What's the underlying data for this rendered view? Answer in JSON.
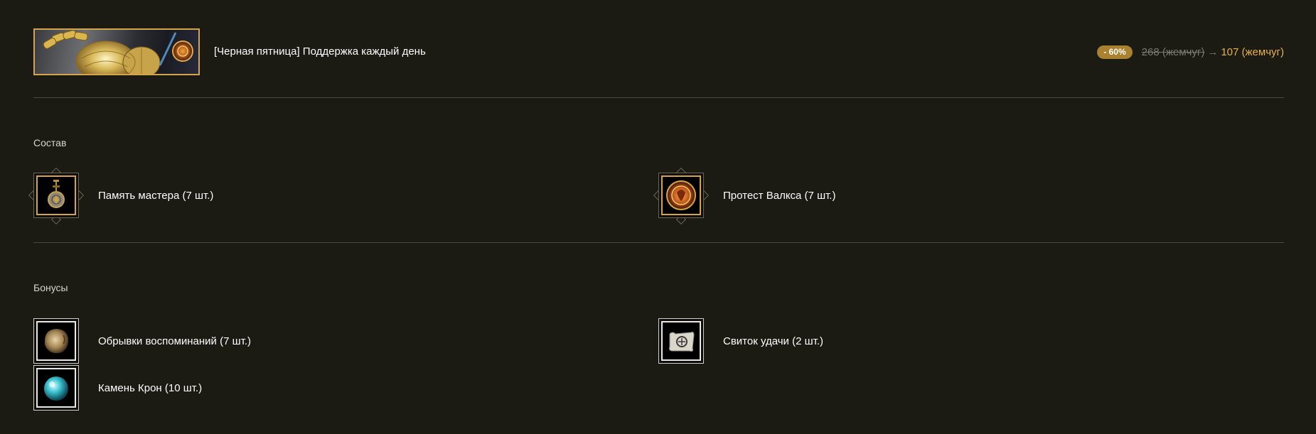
{
  "product": {
    "title": "[Черная пятница] Поддержка каждый день",
    "discount_badge": "- 60%",
    "old_price": "268 (жемчуг)",
    "arrow": "→",
    "new_price": "107 (жемчуг)",
    "banner_icon": "crown-coin-banner-image"
  },
  "composition": {
    "label": "Состав",
    "items": [
      {
        "name": "Память мастера (7 шт.)",
        "icon": "master-memory-pendant-icon"
      },
      {
        "name": "Протест Валкса (7 шт.)",
        "icon": "valks-protest-coin-icon"
      }
    ]
  },
  "bonuses": {
    "label": "Бонусы",
    "items": [
      {
        "name": "Обрывки воспоминаний (7 шт.)",
        "icon": "memory-fragment-icon"
      },
      {
        "name": "Свиток удачи (2 шт.)",
        "icon": "luck-scroll-icon"
      },
      {
        "name": "Камень Крон (10 шт.)",
        "icon": "cron-stone-icon"
      }
    ]
  },
  "colors": {
    "background": "#1b1a13",
    "accent_gold": "#e9b04a",
    "badge": "#a9812f",
    "divider": "#4a4840"
  }
}
